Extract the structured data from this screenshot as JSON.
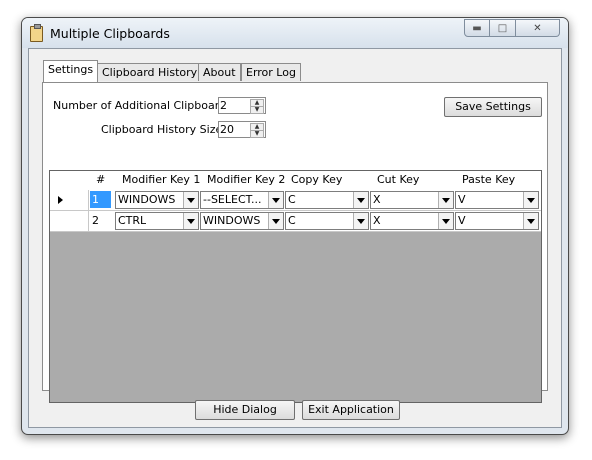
{
  "window": {
    "title": "Multiple Clipboards"
  },
  "tabs": [
    {
      "label": "Settings",
      "active": true
    },
    {
      "label": "Clipboard History",
      "active": false
    },
    {
      "label": "About",
      "active": false
    },
    {
      "label": "Error Log",
      "active": false
    }
  ],
  "settings": {
    "additional_clipboards_label": "Number of Additional Clipboards",
    "additional_clipboards_value": "2",
    "history_size_label": "Clipboard History Size",
    "history_size_value": "20",
    "save_label": "Save Settings"
  },
  "grid": {
    "columns": [
      "#",
      "Modifier Key 1",
      "Modifier Key 2",
      "Copy Key",
      "Cut Key",
      "Paste Key"
    ],
    "rows": [
      {
        "num": "1",
        "mod1": "WINDOWS",
        "mod2": "--SELECT...",
        "copy": "C",
        "cut": "X",
        "paste": "V",
        "selected": true
      },
      {
        "num": "2",
        "mod1": "CTRL",
        "mod2": "WINDOWS",
        "copy": "C",
        "cut": "X",
        "paste": "V",
        "selected": false
      }
    ]
  },
  "footer": {
    "hide_label": "Hide Dialog",
    "exit_label": "Exit Application"
  }
}
